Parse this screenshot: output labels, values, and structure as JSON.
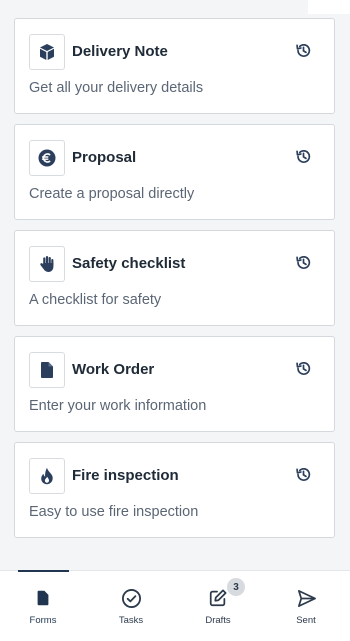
{
  "forms": [
    {
      "title": "Delivery Note",
      "description": "Get all your delivery details",
      "icon": "cube-icon"
    },
    {
      "title": "Proposal",
      "description": "Create a proposal directly",
      "icon": "euro-icon"
    },
    {
      "title": "Safety checklist",
      "description": "A checklist for safety",
      "icon": "hand-icon"
    },
    {
      "title": "Work Order",
      "description": "Enter your work information",
      "icon": "document-icon"
    },
    {
      "title": "Fire inspection",
      "description": "Easy to use fire inspection",
      "icon": "flame-icon"
    }
  ],
  "tabbar": {
    "forms": {
      "label": "Forms",
      "icon": "document-icon",
      "active": true
    },
    "tasks": {
      "label": "Tasks",
      "icon": "check-circle-icon"
    },
    "drafts": {
      "label": "Drafts",
      "icon": "edit-icon",
      "badge": "3"
    },
    "sent": {
      "label": "Sent",
      "icon": "send-icon"
    }
  },
  "colors": {
    "icon": "#2b3f5c",
    "accent": "#1f3550",
    "text": "#202b38",
    "muted": "#5b6675",
    "background": "#f4f5f6"
  }
}
